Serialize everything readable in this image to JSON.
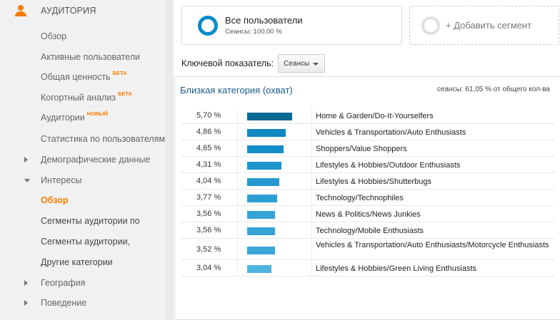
{
  "sidebar": {
    "header": {
      "icon": "person-icon",
      "label": "АУДИТОРИЯ"
    },
    "items": [
      {
        "label": "Обзор",
        "badge": "",
        "style": "normal",
        "toggle": ""
      },
      {
        "label": "Активные пользователи",
        "badge": "",
        "style": "normal",
        "toggle": ""
      },
      {
        "label": "Общая ценность",
        "badge": "БЕТА",
        "style": "normal",
        "toggle": ""
      },
      {
        "label": "Когортный анализ",
        "badge": "БЕТА",
        "style": "normal",
        "toggle": ""
      },
      {
        "label": "Аудитории",
        "badge": "НОВЫЙ",
        "style": "normal",
        "toggle": ""
      },
      {
        "label": "Статистика по пользователям",
        "badge": "",
        "style": "normal",
        "toggle": ""
      },
      {
        "label": "Демографические данные",
        "badge": "",
        "style": "normal",
        "toggle": "right"
      },
      {
        "label": "Интересы",
        "badge": "",
        "style": "normal",
        "toggle": "down"
      },
      {
        "label": "Обзор",
        "badge": "",
        "style": "active",
        "toggle": ""
      },
      {
        "label": "Сегменты аудитории по",
        "badge": "",
        "style": "dark",
        "toggle": ""
      },
      {
        "label": "Сегменты аудитории,",
        "badge": "",
        "style": "dark",
        "toggle": ""
      },
      {
        "label": "Другие категории",
        "badge": "",
        "style": "dark",
        "toggle": ""
      },
      {
        "label": "География",
        "badge": "",
        "style": "normal",
        "toggle": "right"
      },
      {
        "label": "Поведение",
        "badge": "",
        "style": "normal",
        "toggle": "right"
      }
    ]
  },
  "segments": {
    "main": {
      "title": "Все пользователи",
      "subtitle": "Сеансы: 100,00 %",
      "ring_color": "#058dc7"
    },
    "add": {
      "label": "+ Добавить сегмент"
    }
  },
  "metric": {
    "label": "Ключевой показатель:",
    "value": "Сеансы"
  },
  "table": {
    "title": "Близкая категория (охват)",
    "subtitle": "сеансы: 61,05 % от общего кол-ва",
    "rows": [
      {
        "pct_label": "5,70 %",
        "value": 5.7,
        "category": "Home & Garden/Do-It-Yourselfers",
        "color": "#0a6a96"
      },
      {
        "pct_label": "4,86 %",
        "value": 4.86,
        "category": "Vehicles & Transportation/Auto Enthusiasts",
        "color": "#1088c2"
      },
      {
        "pct_label": "4,65 %",
        "value": 4.65,
        "category": "Shoppers/Value Shoppers",
        "color": "#148ec8"
      },
      {
        "pct_label": "4,31 %",
        "value": 4.31,
        "category": "Lifestyles & Hobbies/Outdoor Enthusiasts",
        "color": "#1c94cc"
      },
      {
        "pct_label": "4,04 %",
        "value": 4.04,
        "category": "Lifestyles & Hobbies/Shutterbugs",
        "color": "#2599d0"
      },
      {
        "pct_label": "3,77 %",
        "value": 3.77,
        "category": "Technology/Technophiles",
        "color": "#2d9ed3"
      },
      {
        "pct_label": "3,56 %",
        "value": 3.56,
        "category": "News & Politics/News Junkies",
        "color": "#35a3d6"
      },
      {
        "pct_label": "3,56 %",
        "value": 3.56,
        "category": "Technology/Mobile Enthusiasts",
        "color": "#35a3d6"
      },
      {
        "pct_label": "3,52 %",
        "value": 3.52,
        "category": "Vehicles & Transportation/Auto Enthusiasts/Motorcycle Enthusiasts",
        "color": "#3aa6d8"
      },
      {
        "pct_label": "3,04 %",
        "value": 3.04,
        "category": "Lifestyles & Hobbies/Green Living Enthusiasts",
        "color": "#4fb3e0"
      }
    ]
  }
}
